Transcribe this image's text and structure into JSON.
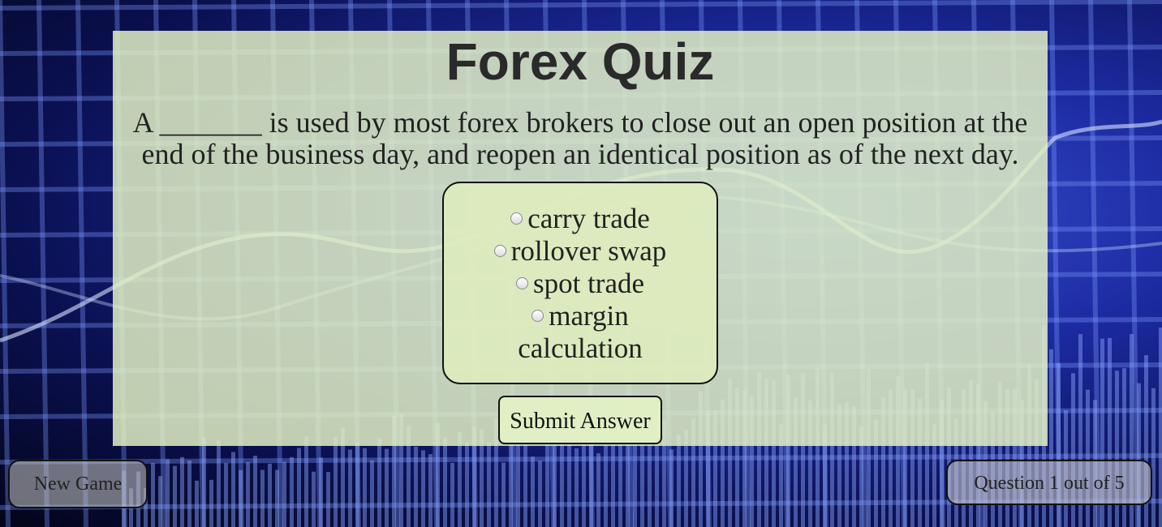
{
  "quiz": {
    "title": "Forex Quiz",
    "question": "A _______ is used by most forex brokers to close out an open position at the end of the business day, and reopen an identical position as of the next day.",
    "options": [
      {
        "label": "carry trade"
      },
      {
        "label": "rollover swap"
      },
      {
        "label": "spot trade"
      },
      {
        "label": "margin calculation"
      }
    ],
    "submit_label": "Submit Answer"
  },
  "footer": {
    "new_game_label": "New Game",
    "counter_text": "Question 1 out of 5"
  },
  "colors": {
    "panel_bg": "#e2f0c4",
    "background_accent": "#3a52d6"
  }
}
